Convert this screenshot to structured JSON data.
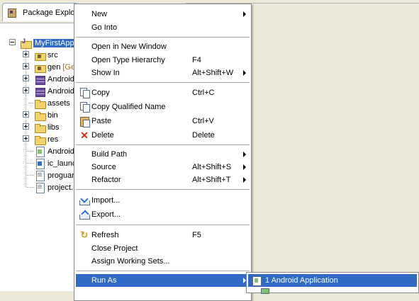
{
  "package_explorer": {
    "tab_title": "Package Explorer",
    "tree": {
      "project": {
        "label": "MyFirstApp"
      },
      "items": [
        {
          "label": "src",
          "icon": "source-folder-icon",
          "expandable": true
        },
        {
          "label": "gen",
          "decoration": "[Ge",
          "icon": "source-folder-icon",
          "expandable": true
        },
        {
          "label": "Android",
          "icon": "library-icon",
          "expandable": true
        },
        {
          "label": "Android",
          "icon": "library-icon",
          "expandable": true
        },
        {
          "label": "assets",
          "icon": "folder-icon",
          "expandable": false
        },
        {
          "label": "bin",
          "icon": "folder-icon",
          "expandable": true
        },
        {
          "label": "libs",
          "icon": "folder-icon",
          "expandable": true
        },
        {
          "label": "res",
          "icon": "folder-icon",
          "expandable": true
        },
        {
          "label": "Android",
          "icon": "xml-file-icon",
          "expandable": false
        },
        {
          "label": "ic_launc",
          "icon": "png-file-icon",
          "expandable": false
        },
        {
          "label": "proguar",
          "icon": "text-file-icon",
          "expandable": false
        },
        {
          "label": "project.",
          "icon": "text-file-icon",
          "expandable": false
        }
      ]
    }
  },
  "context_menu": {
    "items": {
      "new": {
        "label": "New",
        "submenu": true
      },
      "go_into": {
        "label": "Go Into"
      },
      "open_new_window": {
        "label": "Open in New Window"
      },
      "open_type_hierarchy": {
        "label": "Open Type Hierarchy",
        "accelerator": "F4"
      },
      "show_in": {
        "label": "Show In",
        "accelerator": "Alt+Shift+W",
        "submenu": true
      },
      "copy": {
        "label": "Copy",
        "accelerator": "Ctrl+C",
        "icon": "copy-icon"
      },
      "copy_qualified": {
        "label": "Copy Qualified Name",
        "icon": "copy-icon"
      },
      "paste": {
        "label": "Paste",
        "accelerator": "Ctrl+V",
        "icon": "paste-icon"
      },
      "delete": {
        "label": "Delete",
        "accelerator": "Delete",
        "icon": "delete-icon"
      },
      "build_path": {
        "label": "Build Path",
        "submenu": true
      },
      "source": {
        "label": "Source",
        "accelerator": "Alt+Shift+S",
        "submenu": true
      },
      "refactor": {
        "label": "Refactor",
        "accelerator": "Alt+Shift+T",
        "submenu": true
      },
      "import": {
        "label": "Import...",
        "icon": "import-icon"
      },
      "export": {
        "label": "Export...",
        "icon": "export-icon"
      },
      "refresh": {
        "label": "Refresh",
        "accelerator": "F5",
        "icon": "refresh-icon"
      },
      "close_project": {
        "label": "Close Project"
      },
      "assign_working_sets": {
        "label": "Assign Working Sets..."
      },
      "run_as": {
        "label": "Run As",
        "submenu": true,
        "highlighted": true
      }
    }
  },
  "run_as_submenu": {
    "items": [
      {
        "label": "1 Android Application",
        "icon": "android-app-icon",
        "highlighted": true
      }
    ]
  },
  "colors": {
    "selection": "#316ac5",
    "window_background": "#ece9d8",
    "menu_background": "#ffffff"
  }
}
